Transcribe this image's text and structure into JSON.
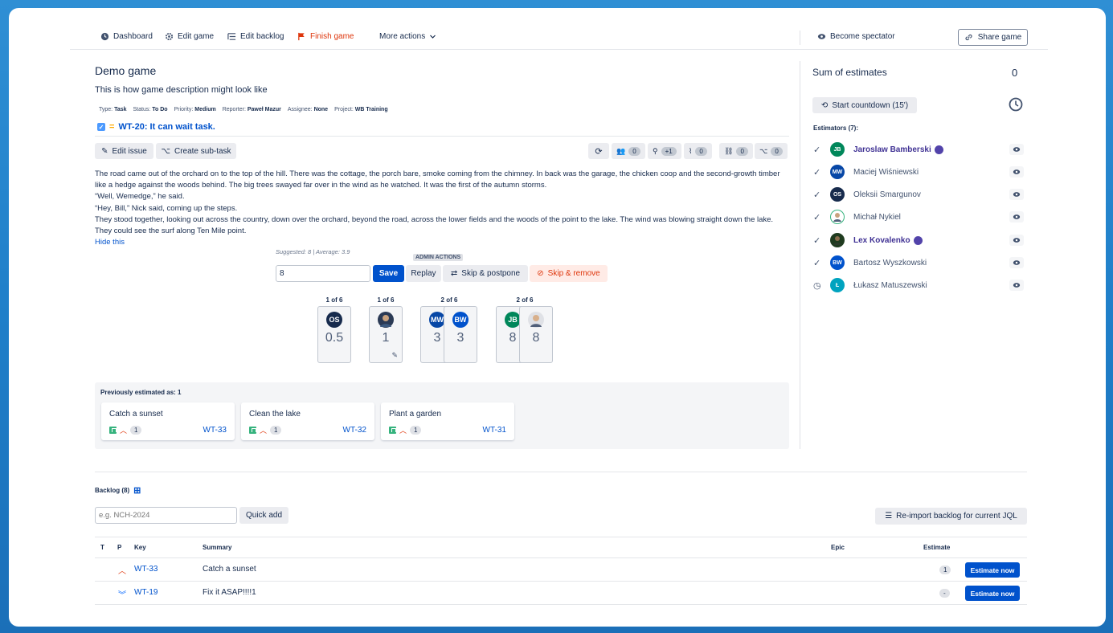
{
  "topbar": {
    "dashboard": "Dashboard",
    "edit_game": "Edit game",
    "edit_backlog": "Edit backlog",
    "finish_game": "Finish game",
    "more_actions": "More actions",
    "become_spectator": "Become spectator",
    "share_game": "Share game"
  },
  "game": {
    "title": "Demo game",
    "description": "This is how game description might look like"
  },
  "issue_meta": {
    "type_label": "Type:",
    "type": "Task",
    "status_label": "Status:",
    "status": "To Do",
    "priority_label": "Priority:",
    "priority": "Medium",
    "reporter_label": "Reporter:",
    "reporter": "Paweł Mazur",
    "assignee_label": "Assignee:",
    "assignee": "None",
    "project_label": "Project:",
    "project": "WB Training"
  },
  "issue": {
    "key_title": "WT-20: It can wait task.",
    "edit_issue": "Edit issue",
    "create_subtask": "Create sub-task",
    "counters": [
      "0",
      "+1",
      "0",
      "0",
      "0"
    ],
    "text": [
      "The road came out of the orchard on to the top of the hill. There was the cottage, the porch bare, smoke coming from the chimney. In back was the garage, the chicken coop and the second-growth timber like a hedge against the woods behind. The big trees swayed far over in the wind as he watched. It was the first of the autumn storms.",
      "“Well, Wemedge,” he said.",
      "“Hey, Bill,” Nick said, coming up the steps.",
      "They stood together, looking out across the country, down over the orchard, beyond the road, across the lower fields and the woods of the point to the lake. The wind was blowing straight down the lake. They could see the surf along Ten Mile point."
    ],
    "hide": "Hide this"
  },
  "admin": {
    "suggested": "Suggested: 8 | Average: 3.9",
    "label": "ADMIN ACTIONS",
    "input_value": "8",
    "save": "Save",
    "replay": "Replay",
    "skip_postpone": "Skip & postpone",
    "skip_remove": "Skip & remove"
  },
  "vote_groups": [
    {
      "label": "1 of 6",
      "cards": [
        {
          "initials": "OS",
          "color": "#172b4d",
          "value": "0.5"
        }
      ]
    },
    {
      "label": "1 of 6",
      "cards": [
        {
          "initials": "",
          "color": "#2b3a55",
          "value": "1"
        }
      ]
    },
    {
      "label": "2 of 6",
      "cards": [
        {
          "initials": "MW",
          "color": "#0747a6",
          "value": "3"
        },
        {
          "initials": "BW",
          "color": "#0052cc",
          "value": "3"
        }
      ]
    },
    {
      "label": "2 of 6",
      "cards": [
        {
          "initials": "JB",
          "color": "#00875a",
          "value": "8"
        },
        {
          "initials": "",
          "color": "#c1c7d0",
          "value": "8"
        }
      ]
    }
  ],
  "previous": {
    "label": "Previously estimated as: 1",
    "items": [
      {
        "title": "Catch a sunset",
        "estimate": "1",
        "key": "WT-33"
      },
      {
        "title": "Clean the lake",
        "estimate": "1",
        "key": "WT-32"
      },
      {
        "title": "Plant a garden",
        "estimate": "1",
        "key": "WT-31"
      }
    ]
  },
  "sidebar": {
    "sum_label": "Sum of estimates",
    "sum_value": "0",
    "countdown": "Start countdown (15')",
    "estimators_label": "Estimators (7):",
    "estimators": [
      {
        "name": "Jaroslaw Bamberski",
        "initials": "JB",
        "color": "#00875a",
        "status": "✓",
        "highlight": true
      },
      {
        "name": "Maciej Wiśniewski",
        "initials": "MW",
        "color": "#0747a6",
        "status": "✓",
        "highlight": false
      },
      {
        "name": "Oleksii Smargunov",
        "initials": "OS",
        "color": "#172b4d",
        "status": "✓",
        "highlight": false
      },
      {
        "name": "Michał Nykiel",
        "initials": "",
        "color": "#36b37e",
        "status": "✓",
        "highlight": false
      },
      {
        "name": "Lex Kovalenko",
        "initials": "",
        "color": "#1f3b1f",
        "status": "✓",
        "highlight": true
      },
      {
        "name": "Bartosz Wyszkowski",
        "initials": "BW",
        "color": "#0052cc",
        "status": "✓",
        "highlight": false
      },
      {
        "name": "Łukasz Matuszewski",
        "initials": "Ł",
        "color": "#00a3bf",
        "status": "◷",
        "highlight": false
      }
    ]
  },
  "backlog": {
    "label": "Backlog (8)",
    "placeholder": "e.g. NCH-2024",
    "quick_add": "Quick add",
    "reimport": "Re-import backlog for current JQL",
    "headers": {
      "t": "T",
      "p": "P",
      "key": "Key",
      "summary": "Summary",
      "epic": "Epic",
      "estimate": "Estimate"
    },
    "rows": [
      {
        "type": "story",
        "key": "WT-33",
        "summary": "Catch a sunset",
        "estimate": "1",
        "action": "Estimate now"
      },
      {
        "type": "bug",
        "key": "WT-19",
        "summary": "Fix it ASAP!!!!1",
        "estimate": "-",
        "action": "Estimate now"
      }
    ]
  }
}
